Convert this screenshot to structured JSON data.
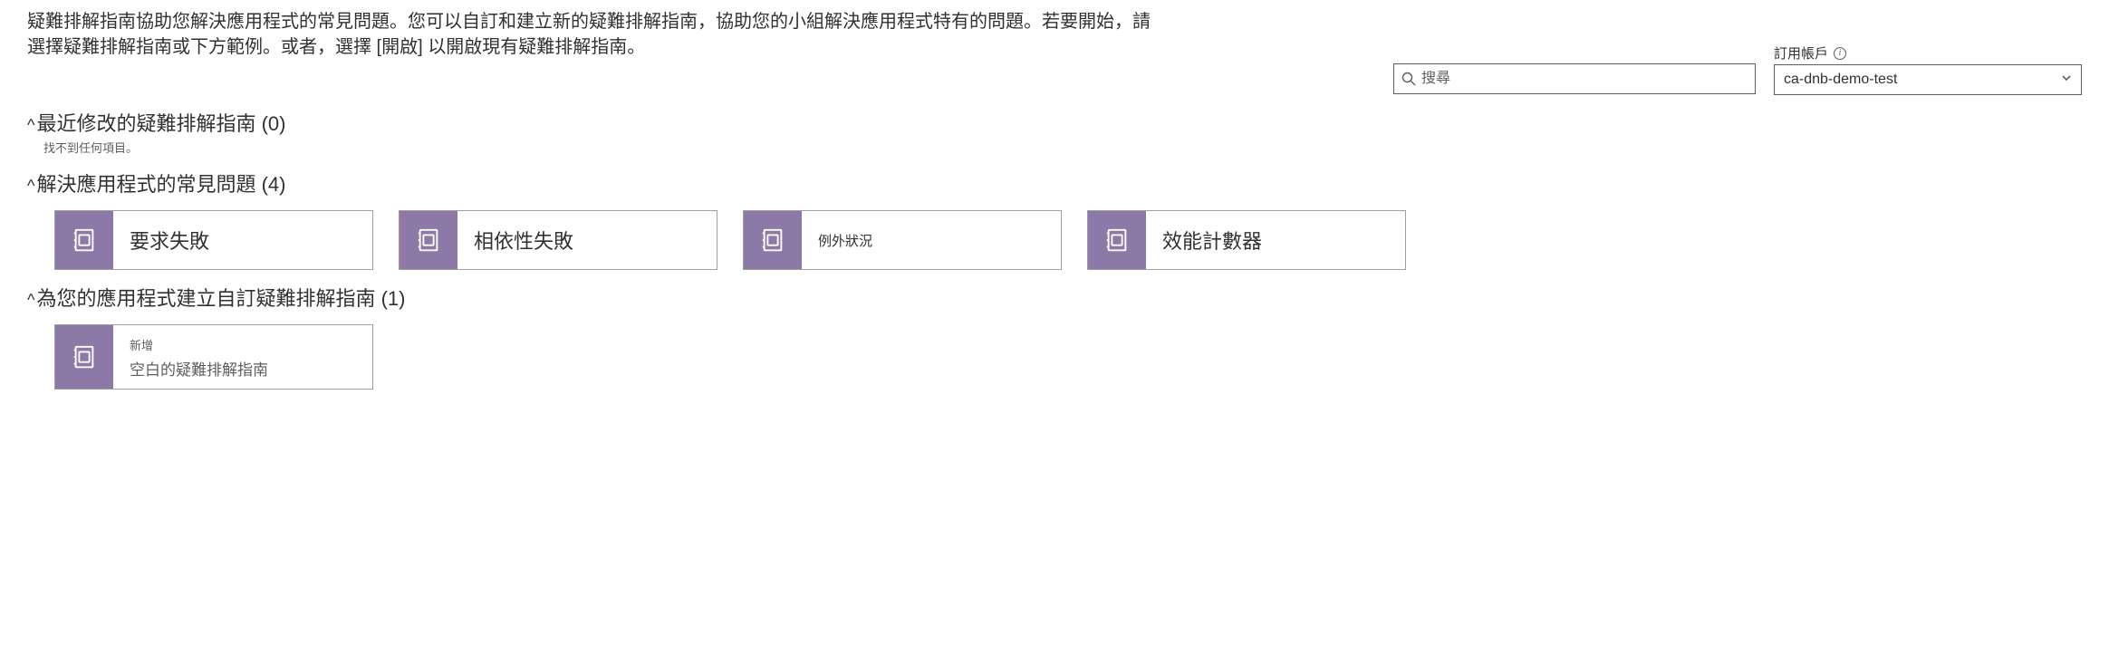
{
  "description": "疑難排解指南協助您解決應用程式的常見問題。您可以自訂和建立新的疑難排解指南，協助您的小組解決應用程式特有的問題。若要開始，請選擇疑難排解指南或下方範例。或者，選擇 [開啟] 以開啟現有疑難排解指南。",
  "search": {
    "placeholder": "搜尋"
  },
  "subscription": {
    "label": "訂用帳戶",
    "value": "ca-dnb-demo-test"
  },
  "sections": {
    "recent": {
      "title": "最近修改的疑難排解指南 (0)",
      "empty": "找不到任何項目。"
    },
    "common": {
      "title": "解決應用程式的常見問題 (4)",
      "items": [
        {
          "label": "要求失敗"
        },
        {
          "label": "相依性失敗"
        },
        {
          "label": "例外狀況"
        },
        {
          "label": "效能計數器"
        }
      ]
    },
    "custom": {
      "title": "為您的應用程式建立自訂疑難排解指南 (1)",
      "items": [
        {
          "label": "新增",
          "sub": "空白的疑難排解指南"
        }
      ]
    }
  }
}
